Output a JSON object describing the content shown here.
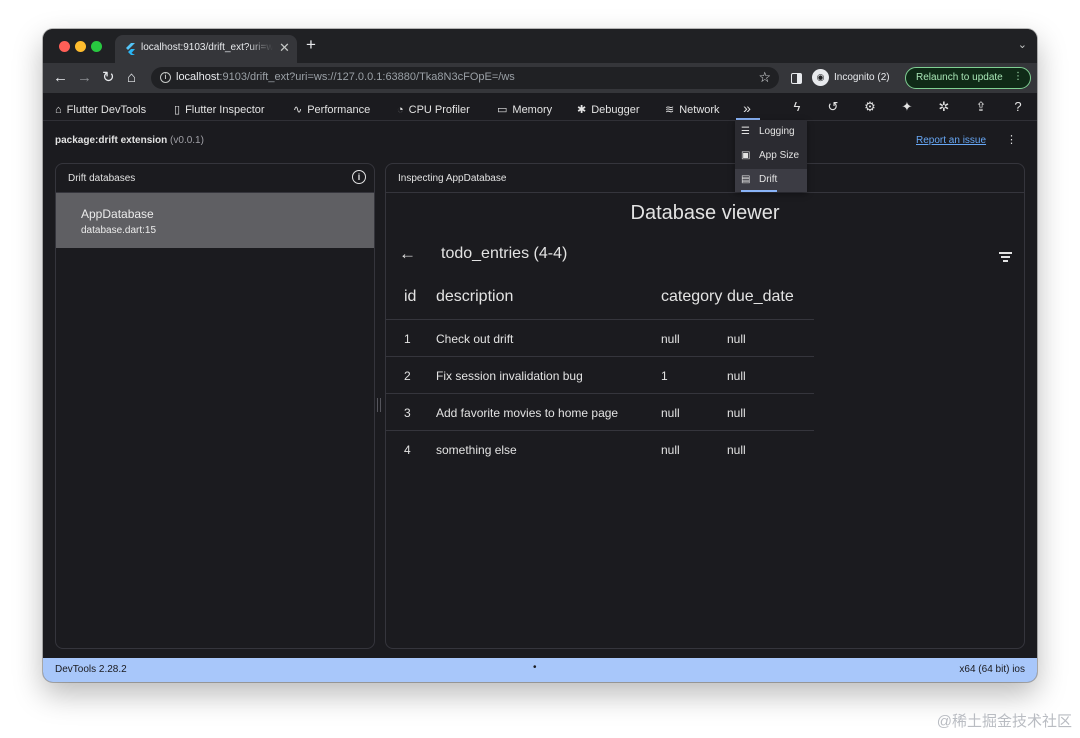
{
  "browser": {
    "tab_title": "localhost:9103/drift_ext?uri=ws://127.0.0.1:63880/Tka8N3cFOpE=/ws",
    "tab_close": "✕",
    "new_tab": "+",
    "url_host": "localhost",
    "url_rest": ":9103/drift_ext?uri=ws://127.0.0.1:63880/Tka8N3cFOpE=/ws",
    "profile_label": "Incognito (2)",
    "relaunch_label": "Relaunch to update"
  },
  "devtools_nav": {
    "items": [
      {
        "icon": "home-icon",
        "label": "Flutter DevTools"
      },
      {
        "icon": "phone-icon",
        "label": "Flutter Inspector"
      },
      {
        "icon": "pulse-icon",
        "label": "Performance"
      },
      {
        "icon": "gauge-icon",
        "label": "CPU Profiler"
      },
      {
        "icon": "memory-icon",
        "label": "Memory"
      },
      {
        "icon": "bug-icon",
        "label": "Debugger"
      },
      {
        "icon": "wifi-icon",
        "label": "Network"
      }
    ],
    "more_label": "»",
    "overflow_menu": [
      {
        "icon": "logging-icon",
        "label": "Logging"
      },
      {
        "icon": "app-size-icon",
        "label": "App Size"
      },
      {
        "icon": "drift-icon",
        "label": "Drift",
        "selected": true
      }
    ]
  },
  "extension": {
    "name": "package:drift extension",
    "version": "(v0.0.1)",
    "report_link": "Report an issue"
  },
  "left_panel": {
    "title": "Drift databases",
    "databases": [
      {
        "name": "AppDatabase",
        "location": "database.dart:15"
      }
    ]
  },
  "right_panel": {
    "title": "Inspecting AppDatabase",
    "viewer_title": "Database viewer",
    "table_name": "todo_entries (4-4)",
    "columns": [
      "id",
      "description",
      "category",
      "due_date"
    ],
    "rows": [
      [
        "1",
        "Check out drift",
        "null",
        "null"
      ],
      [
        "2",
        "Fix session invalidation bug",
        "1",
        "null"
      ],
      [
        "3",
        "Add favorite movies to home page",
        "null",
        "null"
      ],
      [
        "4",
        "something else",
        "null",
        "null"
      ]
    ]
  },
  "status_bar": {
    "left": "DevTools 2.28.2",
    "center": "•",
    "right": "x64 (64 bit) ios"
  },
  "watermark": "@稀土掘金技术社区",
  "colors": {
    "background": "#1b1b1f",
    "status_bar": "#a8c7fa",
    "selected_db": "#5f5f63",
    "accent": "#8ab4f8",
    "link": "#67a7f5",
    "relaunch": "#a8e6b6"
  }
}
